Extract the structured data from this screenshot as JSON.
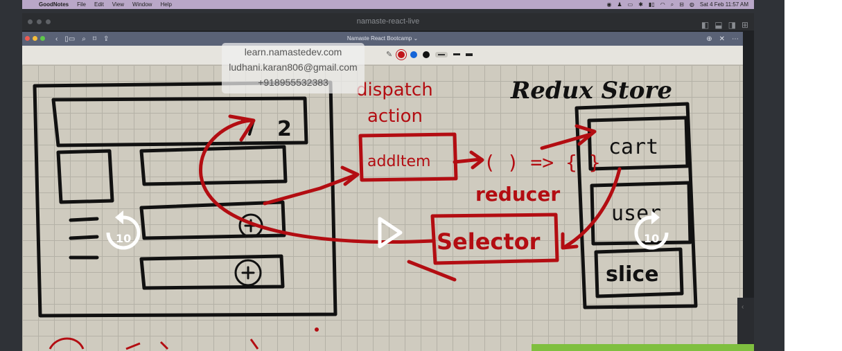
{
  "menubar": {
    "apple": "",
    "app_name": "GoodNotes",
    "items": [
      "File",
      "Edit",
      "View",
      "Window",
      "Help"
    ],
    "datetime": "Sat 4 Feb  11:57 AM"
  },
  "outer_window": {
    "title": "namaste-react-live"
  },
  "inner_window": {
    "title": "Namaste React Bootcamp ⌄"
  },
  "watermark": {
    "site": "learn.namastedev.com",
    "email": "ludhani.karan806@gmail.com",
    "phone": "+918955532383"
  },
  "sketch_labels": {
    "heading": "Redux Store",
    "dispatch": "dispatch",
    "action": "action",
    "add_item": "addItem",
    "fn": "( ) => { }",
    "reducer": "reducer",
    "selector": "Selector",
    "cart": "cart",
    "user": "user",
    "slice": "slice",
    "badge": "2"
  },
  "player": {
    "rewind_label": "10",
    "forward_label": "10"
  },
  "colors": {
    "ink": "#b30d12",
    "bg": "#cfcbbf"
  }
}
